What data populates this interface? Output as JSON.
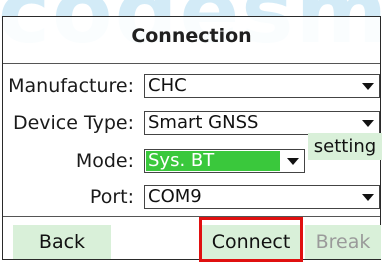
{
  "watermark": "codesm",
  "dialog": {
    "title": "Connection",
    "fields": {
      "manufacture": {
        "label": "Manufacture:",
        "value": "CHC"
      },
      "device_type": {
        "label": "Device Type:",
        "value": "Smart GNSS"
      },
      "mode": {
        "label": "Mode:",
        "value": "Sys. BT",
        "highlight_color": "#3ac83c"
      },
      "port": {
        "label": "Port:",
        "value": "COM9"
      }
    },
    "setting_label": "setting",
    "buttons": {
      "back": "Back",
      "connect": "Connect",
      "break": "Break"
    },
    "connect_highlight_color": "#e01010"
  }
}
